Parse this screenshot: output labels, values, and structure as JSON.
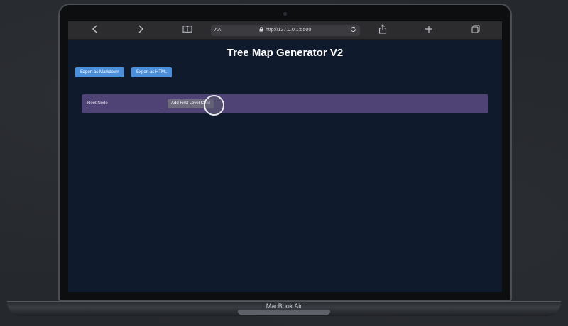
{
  "browser": {
    "url": "http://127.0.0.1:5500",
    "reader_label": "AA",
    "icons": {
      "back": "chevron-left-icon",
      "forward": "chevron-right-icon",
      "bookmarks": "book-icon",
      "reload": "reload-icon",
      "share": "share-icon",
      "new_tab": "plus-icon",
      "tabs": "tabs-icon"
    }
  },
  "page": {
    "title": "Tree Map Generator V2",
    "export_markdown_label": "Export as Markdown",
    "export_html_label": "Export as HTML",
    "root_node_value": "Root Node",
    "add_child_label": "Add First Level Child"
  },
  "device": {
    "label": "MacBook Air"
  },
  "colors": {
    "page_background": "#0f1a2c",
    "button_blue": "#4a8fdb",
    "tree_row": "#4f4375"
  }
}
